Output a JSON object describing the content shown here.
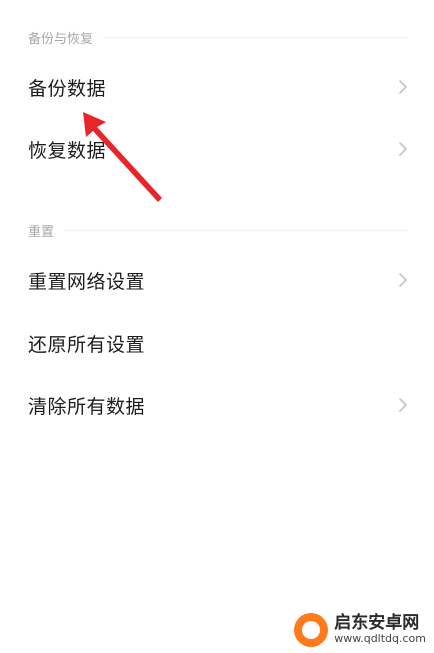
{
  "sections": [
    {
      "header": "备份与恢复",
      "items": [
        {
          "label": "备份数据",
          "chevron": true
        },
        {
          "label": "恢复数据",
          "chevron": true
        }
      ]
    },
    {
      "header": "重置",
      "items": [
        {
          "label": "重置网络设置",
          "chevron": true
        },
        {
          "label": "还原所有设置",
          "chevron": false
        },
        {
          "label": "清除所有数据",
          "chevron": true
        }
      ]
    }
  ],
  "annotation": {
    "color": "#e8262a"
  },
  "watermark": {
    "title": "启东安卓网",
    "url": "www.qdltdq.com",
    "logo_color": "#ff7a1a"
  },
  "colors": {
    "background": "#ffffff",
    "header_text": "#a8a8a8",
    "item_text": "#1d1d1d",
    "chevron": "#c4c4c4"
  }
}
